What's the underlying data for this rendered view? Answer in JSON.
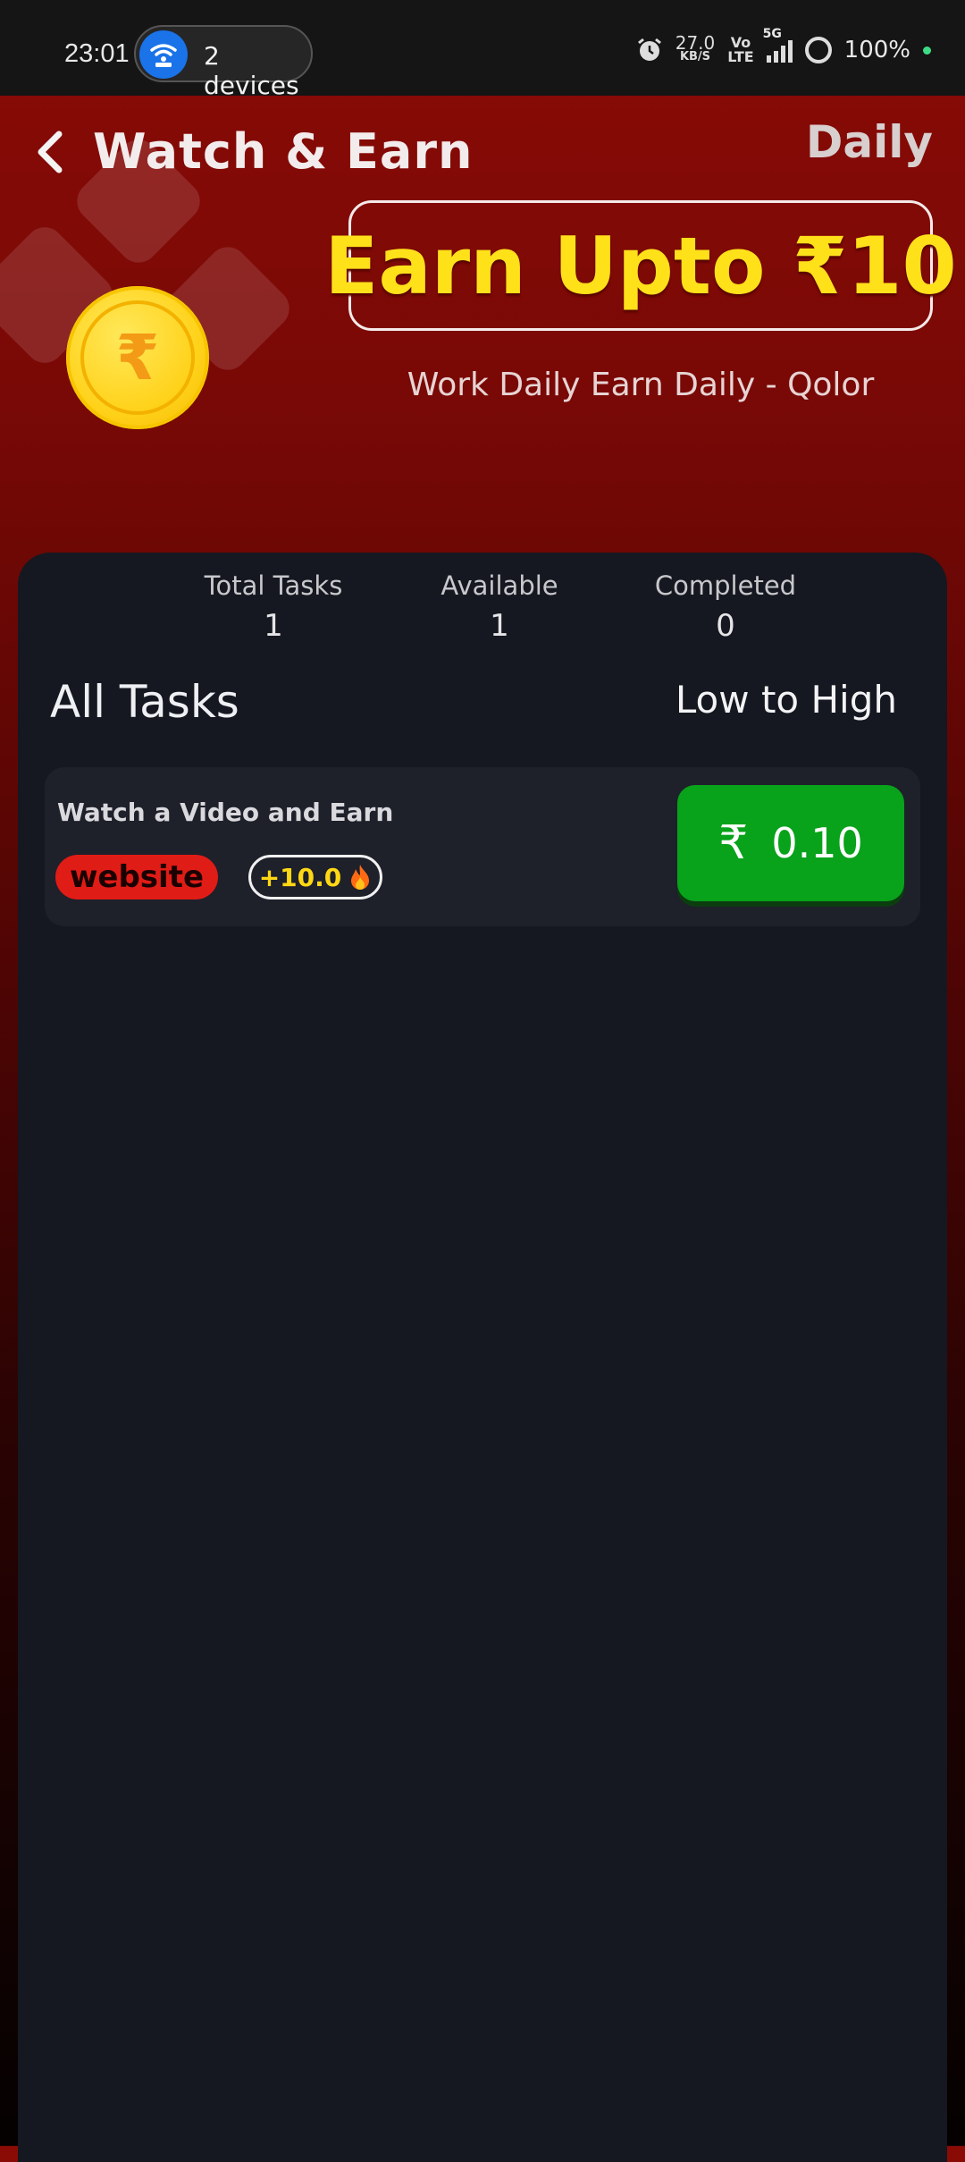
{
  "status_bar": {
    "time": "23:01",
    "hotspot_label": "2 devices",
    "speed_value": "27.0",
    "speed_unit": "KB/S",
    "volte_top": "Vo",
    "volte_bottom": "LTE",
    "network": "5G",
    "battery": "100%"
  },
  "header": {
    "title": "Watch & Earn",
    "right_link": "Daily"
  },
  "banner": {
    "headline": "Earn Upto ₹10",
    "tagline": "Work Daily Earn Daily - Qolor",
    "coin_symbol": "₹"
  },
  "stats": [
    {
      "label": "Total Tasks",
      "value": "1"
    },
    {
      "label": "Available",
      "value": "1"
    },
    {
      "label": "Completed",
      "value": "0"
    }
  ],
  "tasks_section": {
    "heading": "All Tasks",
    "sort_label": "Low to High"
  },
  "tasks": [
    {
      "title": "Watch a Video and Earn",
      "tag": "website",
      "bonus": "+10.0",
      "currency": "₹",
      "reward": "0.10"
    }
  ],
  "colors": {
    "accent_yellow": "#ffe11a",
    "reward_green": "#08a21b",
    "tag_red": "#e01c16",
    "panel_bg": "#151820"
  }
}
